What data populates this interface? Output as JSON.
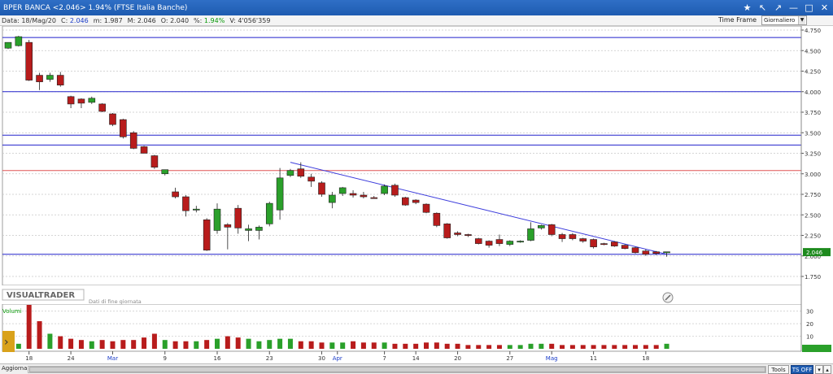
{
  "window": {
    "title": "BPER BANCA <2.046> 1.94%  (FTSE Italia Banche)",
    "buttons": [
      "★",
      "↖",
      "↗",
      "—",
      "□",
      "✕"
    ]
  },
  "info": {
    "date": "Data: 18/Mag/20",
    "close_label": "C:",
    "close_value": "2.046",
    "min_label": "m:",
    "min_value": "1.987",
    "max_label": "M:",
    "max_value": "2.046",
    "open_label": "O:",
    "open_value": "2.040",
    "pct_label": "%:",
    "pct_value": "1.94%",
    "vol_label": "V:",
    "vol_value": "4'056'359"
  },
  "timeframe": {
    "label": "Time Frame",
    "value": "Giornaliero"
  },
  "watermark": {
    "brand": "VISUALTRADER",
    "note": "Dati di fine giornata"
  },
  "volume_label": "Volumi",
  "bottom": {
    "aggiorna": "Aggiorna",
    "tools": "Tools",
    "ts": "TS OFF"
  },
  "colors": {
    "up": "#2aa02a",
    "down": "#b81c1c",
    "hline": "#2222cc",
    "resistance": "#e05555",
    "trend": "#3c3cdc",
    "grid": "#c8c8c8"
  },
  "chart_data": {
    "type": "candlestick",
    "price_axis": {
      "min": 1.75,
      "max": 4.75,
      "ticks": [
        "4.750",
        "4.500",
        "4.250",
        "4.000",
        "3.750",
        "3.500",
        "3.250",
        "3.000",
        "2.750",
        "2.500",
        "2.250",
        "2.000",
        "1.750"
      ]
    },
    "last_price": "2.046",
    "date_ticks": [
      {
        "label": "18",
        "index": 2
      },
      {
        "label": "24",
        "index": 6
      },
      {
        "label": "Mar",
        "index": 10
      },
      {
        "label": "9",
        "index": 15
      },
      {
        "label": "16",
        "index": 20
      },
      {
        "label": "23",
        "index": 25
      },
      {
        "label": "30",
        "index": 30
      },
      {
        "label": "Apr",
        "index": 31.5
      },
      {
        "label": "7",
        "index": 36
      },
      {
        "label": "14",
        "index": 39
      },
      {
        "label": "20",
        "index": 43
      },
      {
        "label": "27",
        "index": 48
      },
      {
        "label": "Mag",
        "index": 52
      },
      {
        "label": "11",
        "index": 56
      },
      {
        "label": "18",
        "index": 61
      }
    ],
    "volume_axis": {
      "max": 35,
      "ticks": [
        "30",
        "20",
        "10"
      ]
    },
    "horizontal_lines": [
      4.66,
      4.0,
      3.47,
      3.35,
      2.02
    ],
    "resistance_line": 3.04,
    "trendline": {
      "from": [
        27,
        3.14
      ],
      "to": [
        63,
        2.02
      ]
    },
    "candles": [
      {
        "o": 4.53,
        "h": 4.6,
        "l": 4.52,
        "c": 4.6
      },
      {
        "o": 4.56,
        "h": 4.68,
        "l": 4.55,
        "c": 4.67
      },
      {
        "o": 4.6,
        "h": 4.63,
        "l": 4.13,
        "c": 4.14
      },
      {
        "o": 4.2,
        "h": 4.23,
        "l": 4.02,
        "c": 4.12
      },
      {
        "o": 4.15,
        "h": 4.23,
        "l": 4.12,
        "c": 4.2
      },
      {
        "o": 4.2,
        "h": 4.24,
        "l": 4.06,
        "c": 4.08
      },
      {
        "o": 3.94,
        "h": 3.95,
        "l": 3.8,
        "c": 3.85
      },
      {
        "o": 3.91,
        "h": 3.92,
        "l": 3.8,
        "c": 3.86
      },
      {
        "o": 3.87,
        "h": 3.94,
        "l": 3.85,
        "c": 3.92
      },
      {
        "o": 3.85,
        "h": 3.86,
        "l": 3.75,
        "c": 3.76
      },
      {
        "o": 3.73,
        "h": 3.74,
        "l": 3.58,
        "c": 3.6
      },
      {
        "o": 3.66,
        "h": 3.67,
        "l": 3.43,
        "c": 3.45
      },
      {
        "o": 3.5,
        "h": 3.52,
        "l": 3.3,
        "c": 3.31
      },
      {
        "o": 3.33,
        "h": 3.34,
        "l": 3.25,
        "c": 3.25
      },
      {
        "o": 3.22,
        "h": 3.23,
        "l": 3.06,
        "c": 3.08
      },
      {
        "o": 3.0,
        "h": 3.05,
        "l": 2.98,
        "c": 3.05
      },
      {
        "o": 2.78,
        "h": 2.83,
        "l": 2.7,
        "c": 2.72
      },
      {
        "o": 2.72,
        "h": 2.74,
        "l": 2.48,
        "c": 2.55
      },
      {
        "o": 2.57,
        "h": 2.61,
        "l": 2.53,
        "c": 2.57
      },
      {
        "o": 2.44,
        "h": 2.46,
        "l": 2.06,
        "c": 2.07
      },
      {
        "o": 2.31,
        "h": 2.64,
        "l": 2.27,
        "c": 2.57
      },
      {
        "o": 2.38,
        "h": 2.4,
        "l": 2.08,
        "c": 2.35
      },
      {
        "o": 2.58,
        "h": 2.62,
        "l": 2.27,
        "c": 2.34
      },
      {
        "o": 2.31,
        "h": 2.38,
        "l": 2.18,
        "c": 2.33
      },
      {
        "o": 2.31,
        "h": 2.37,
        "l": 2.2,
        "c": 2.35
      },
      {
        "o": 2.39,
        "h": 2.66,
        "l": 2.36,
        "c": 2.64
      },
      {
        "o": 2.56,
        "h": 3.07,
        "l": 2.44,
        "c": 2.95
      },
      {
        "o": 2.98,
        "h": 3.06,
        "l": 2.96,
        "c": 3.04
      },
      {
        "o": 3.06,
        "h": 3.14,
        "l": 2.95,
        "c": 2.97
      },
      {
        "o": 2.96,
        "h": 3.0,
        "l": 2.84,
        "c": 2.91
      },
      {
        "o": 2.89,
        "h": 2.91,
        "l": 2.72,
        "c": 2.75
      },
      {
        "o": 2.65,
        "h": 2.78,
        "l": 2.58,
        "c": 2.74
      },
      {
        "o": 2.76,
        "h": 2.84,
        "l": 2.73,
        "c": 2.83
      },
      {
        "o": 2.76,
        "h": 2.8,
        "l": 2.71,
        "c": 2.74
      },
      {
        "o": 2.74,
        "h": 2.78,
        "l": 2.7,
        "c": 2.72
      },
      {
        "o": 2.71,
        "h": 2.73,
        "l": 2.7,
        "c": 2.7
      },
      {
        "o": 2.76,
        "h": 2.87,
        "l": 2.74,
        "c": 2.85
      },
      {
        "o": 2.86,
        "h": 2.88,
        "l": 2.72,
        "c": 2.74
      },
      {
        "o": 2.71,
        "h": 2.72,
        "l": 2.61,
        "c": 2.62
      },
      {
        "o": 2.68,
        "h": 2.69,
        "l": 2.63,
        "c": 2.65
      },
      {
        "o": 2.63,
        "h": 2.64,
        "l": 2.52,
        "c": 2.53
      },
      {
        "o": 2.52,
        "h": 2.53,
        "l": 2.35,
        "c": 2.37
      },
      {
        "o": 2.39,
        "h": 2.4,
        "l": 2.21,
        "c": 2.22
      },
      {
        "o": 2.28,
        "h": 2.3,
        "l": 2.24,
        "c": 2.26
      },
      {
        "o": 2.26,
        "h": 2.27,
        "l": 2.23,
        "c": 2.25
      },
      {
        "o": 2.21,
        "h": 2.22,
        "l": 2.14,
        "c": 2.15
      },
      {
        "o": 2.18,
        "h": 2.19,
        "l": 2.1,
        "c": 2.13
      },
      {
        "o": 2.2,
        "h": 2.26,
        "l": 2.12,
        "c": 2.15
      },
      {
        "o": 2.14,
        "h": 2.19,
        "l": 2.12,
        "c": 2.18
      },
      {
        "o": 2.17,
        "h": 2.19,
        "l": 2.16,
        "c": 2.18
      },
      {
        "o": 2.19,
        "h": 2.41,
        "l": 2.18,
        "c": 2.33
      },
      {
        "o": 2.34,
        "h": 2.38,
        "l": 2.32,
        "c": 2.37
      },
      {
        "o": 2.38,
        "h": 2.39,
        "l": 2.24,
        "c": 2.26
      },
      {
        "o": 2.26,
        "h": 2.28,
        "l": 2.17,
        "c": 2.21
      },
      {
        "o": 2.26,
        "h": 2.28,
        "l": 2.19,
        "c": 2.21
      },
      {
        "o": 2.21,
        "h": 2.22,
        "l": 2.16,
        "c": 2.18
      },
      {
        "o": 2.2,
        "h": 2.21,
        "l": 2.09,
        "c": 2.11
      },
      {
        "o": 2.15,
        "h": 2.16,
        "l": 2.13,
        "c": 2.14
      },
      {
        "o": 2.17,
        "h": 2.18,
        "l": 2.11,
        "c": 2.12
      },
      {
        "o": 2.13,
        "h": 2.14,
        "l": 2.08,
        "c": 2.09
      },
      {
        "o": 2.1,
        "h": 2.11,
        "l": 2.03,
        "c": 2.04
      },
      {
        "o": 2.06,
        "h": 2.08,
        "l": 2.0,
        "c": 2.02
      },
      {
        "o": 2.05,
        "h": 2.06,
        "l": 2.01,
        "c": 2.03
      },
      {
        "o": 2.04,
        "h": 2.05,
        "l": 1.99,
        "c": 2.05
      }
    ],
    "volumes": [
      3,
      4,
      35,
      22,
      12,
      10,
      8,
      7,
      6,
      7,
      6,
      7,
      7,
      9,
      12,
      7,
      6,
      6,
      6,
      7,
      8,
      10,
      9,
      8,
      6,
      7,
      8,
      8,
      6,
      6,
      5,
      5,
      5,
      6,
      5,
      5,
      5,
      4,
      4,
      4,
      5,
      5,
      4,
      4,
      3,
      3,
      3,
      3,
      3,
      3,
      4,
      4,
      4,
      3,
      3,
      3,
      3,
      3,
      3,
      3,
      3,
      3,
      3,
      4
    ]
  }
}
